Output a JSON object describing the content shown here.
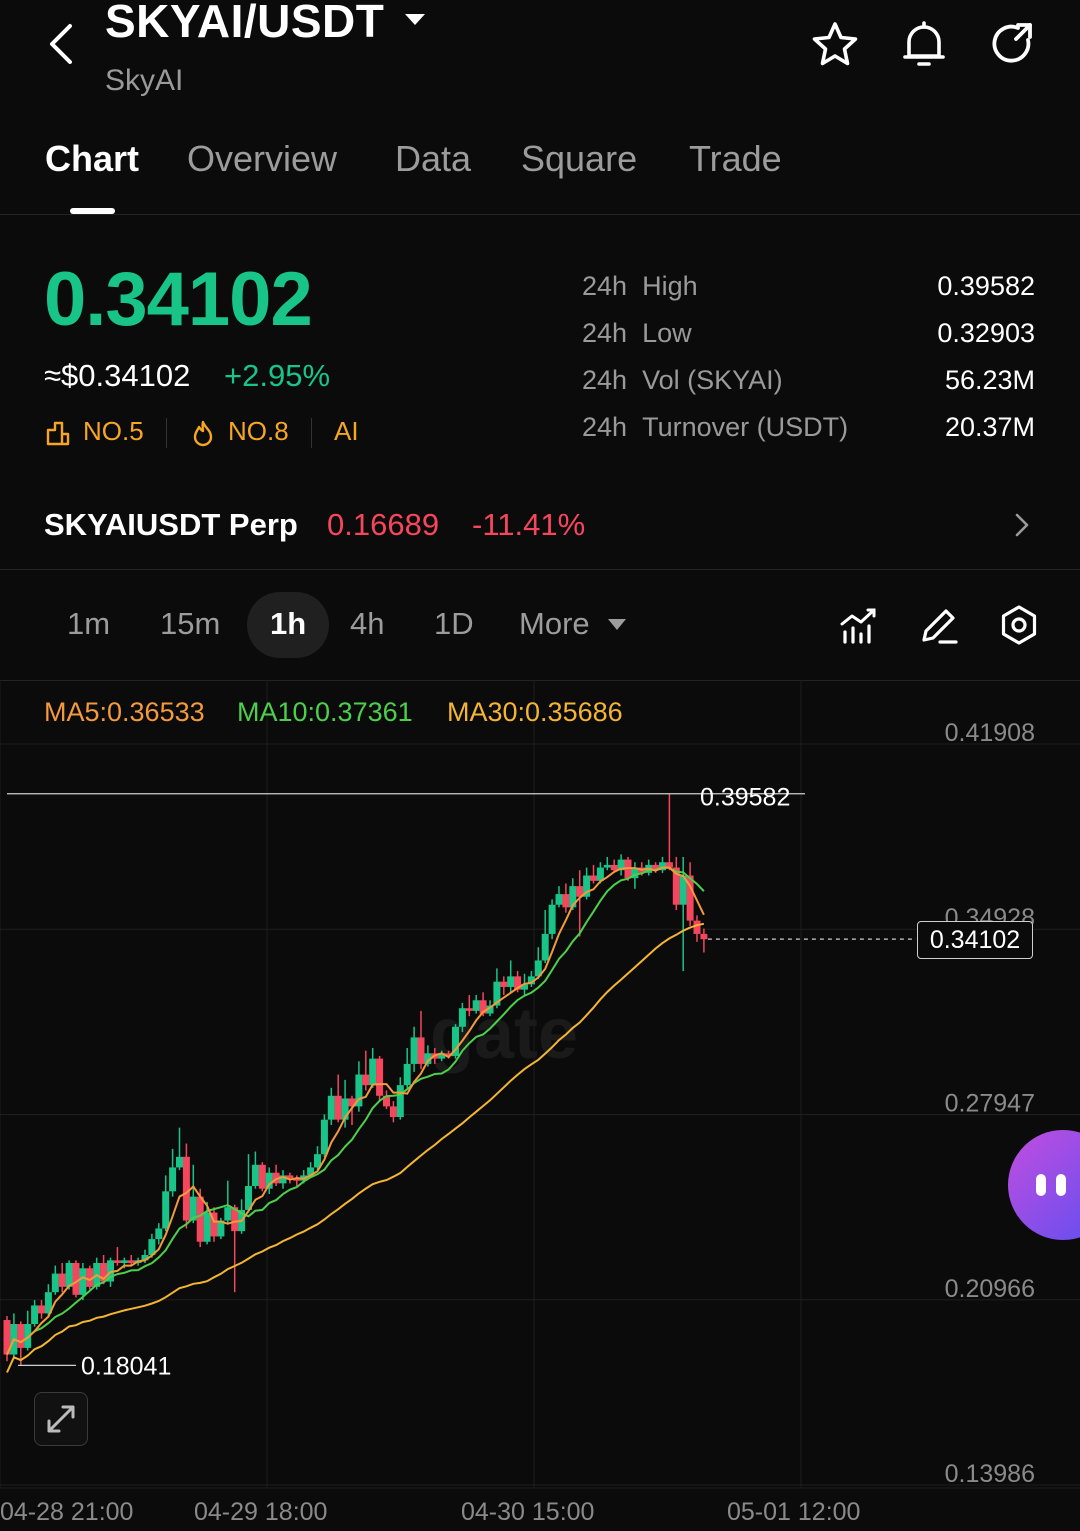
{
  "header": {
    "pair": "SKYAI/USDT",
    "name": "SkyAI"
  },
  "tabs": [
    {
      "label": "Chart",
      "active": true
    },
    {
      "label": "Overview"
    },
    {
      "label": "Data"
    },
    {
      "label": "Square"
    },
    {
      "label": "Trade"
    }
  ],
  "price": {
    "last": "0.34102",
    "usd": "≈$0.34102",
    "change": "+2.95%",
    "badges": [
      {
        "icon": "rank-icon",
        "label": "NO.5"
      },
      {
        "icon": "flame-icon",
        "label": "NO.8"
      },
      {
        "label": "AI"
      }
    ]
  },
  "stats": [
    {
      "period": "24h",
      "label": "High",
      "value": "0.39582"
    },
    {
      "period": "24h",
      "label": "Low",
      "value": "0.32903"
    },
    {
      "period": "24h",
      "label": "Vol (SKYAI)",
      "value": "56.23M"
    },
    {
      "period": "24h",
      "label": "Turnover (USDT)",
      "value": "20.37M"
    }
  ],
  "perp": {
    "name": "SKYAIUSDT Perp",
    "price": "0.16689",
    "change": "-11.41%"
  },
  "intervals": [
    "1m",
    "15m",
    "1h",
    "4h",
    "1D",
    "More"
  ],
  "active_interval": "1h",
  "ma": {
    "ma5": "MA5:0.36533",
    "ma10": "MA10:0.37361",
    "ma30": "MA30:0.35686"
  },
  "colors": {
    "up": "#19c489",
    "down": "#f6465d",
    "ma5": "#f59a3b",
    "ma10": "#4cd04c",
    "ma30": "#f5b533",
    "badge": "#f6a623"
  },
  "watermark": "gate",
  "chart_data": {
    "type": "candlestick",
    "ylim": [
      0.13986,
      0.44
    ],
    "y_ticks": [
      "0.41908",
      "0.34928",
      "0.27947",
      "0.20966",
      "0.13986"
    ],
    "x_ticks": [
      "04-28 21:00",
      "04-29 18:00",
      "04-30 15:00",
      "05-01 12:00"
    ],
    "high_label": "0.39582",
    "low_label": "0.18041",
    "current_price": 0.34102,
    "current_label": "0.34102",
    "candles": [
      [
        0.1975,
        0.1845,
        0.199,
        0.182
      ],
      [
        0.1845,
        0.196,
        0.2,
        0.183
      ],
      [
        0.196,
        0.187,
        0.197,
        0.1804
      ],
      [
        0.187,
        0.196,
        0.201,
        0.186
      ],
      [
        0.196,
        0.203,
        0.205,
        0.195
      ],
      [
        0.203,
        0.2,
        0.205,
        0.198
      ],
      [
        0.2,
        0.208,
        0.211,
        0.199
      ],
      [
        0.208,
        0.215,
        0.218,
        0.207
      ],
      [
        0.215,
        0.21,
        0.219,
        0.208
      ],
      [
        0.21,
        0.219,
        0.22,
        0.209
      ],
      [
        0.219,
        0.207,
        0.22,
        0.206
      ],
      [
        0.207,
        0.217,
        0.219,
        0.205
      ],
      [
        0.217,
        0.21,
        0.218,
        0.209
      ],
      [
        0.21,
        0.219,
        0.221,
        0.209
      ],
      [
        0.219,
        0.212,
        0.222,
        0.211
      ],
      [
        0.212,
        0.22,
        0.221,
        0.21
      ],
      [
        0.22,
        0.219,
        0.225,
        0.218
      ],
      [
        0.219,
        0.22,
        0.221,
        0.217
      ],
      [
        0.22,
        0.219,
        0.222,
        0.218
      ],
      [
        0.219,
        0.22,
        0.221,
        0.218
      ],
      [
        0.22,
        0.222,
        0.224,
        0.219
      ],
      [
        0.222,
        0.228,
        0.23,
        0.221
      ],
      [
        0.228,
        0.232,
        0.234,
        0.226
      ],
      [
        0.232,
        0.246,
        0.252,
        0.231
      ],
      [
        0.246,
        0.255,
        0.262,
        0.244
      ],
      [
        0.255,
        0.259,
        0.27,
        0.254
      ],
      [
        0.259,
        0.235,
        0.264,
        0.232
      ],
      [
        0.235,
        0.244,
        0.256,
        0.234
      ],
      [
        0.244,
        0.227,
        0.247,
        0.225
      ],
      [
        0.227,
        0.238,
        0.242,
        0.226
      ],
      [
        0.238,
        0.229,
        0.24,
        0.227
      ],
      [
        0.229,
        0.235,
        0.236,
        0.228
      ],
      [
        0.235,
        0.24,
        0.25,
        0.234
      ],
      [
        0.24,
        0.231,
        0.241,
        0.208
      ],
      [
        0.231,
        0.239,
        0.243,
        0.23
      ],
      [
        0.239,
        0.248,
        0.26,
        0.238
      ],
      [
        0.248,
        0.256,
        0.261,
        0.247
      ],
      [
        0.256,
        0.247,
        0.257,
        0.246
      ],
      [
        0.247,
        0.253,
        0.255,
        0.245
      ],
      [
        0.253,
        0.249,
        0.256,
        0.248
      ],
      [
        0.249,
        0.252,
        0.254,
        0.247
      ],
      [
        0.252,
        0.251,
        0.253,
        0.249
      ],
      [
        0.251,
        0.25,
        0.252,
        0.248
      ],
      [
        0.25,
        0.252,
        0.254,
        0.249
      ],
      [
        0.252,
        0.255,
        0.257,
        0.251
      ],
      [
        0.255,
        0.26,
        0.263,
        0.254
      ],
      [
        0.26,
        0.273,
        0.275,
        0.259
      ],
      [
        0.273,
        0.282,
        0.285,
        0.271
      ],
      [
        0.282,
        0.273,
        0.29,
        0.272
      ],
      [
        0.273,
        0.281,
        0.288,
        0.27
      ],
      [
        0.281,
        0.278,
        0.282,
        0.271
      ],
      [
        0.278,
        0.29,
        0.295,
        0.276
      ],
      [
        0.29,
        0.286,
        0.299,
        0.284
      ],
      [
        0.286,
        0.296,
        0.3,
        0.285
      ],
      [
        0.296,
        0.282,
        0.297,
        0.28
      ],
      [
        0.282,
        0.278,
        0.284,
        0.277
      ],
      [
        0.278,
        0.274,
        0.28,
        0.272
      ],
      [
        0.274,
        0.286,
        0.289,
        0.273
      ],
      [
        0.286,
        0.294,
        0.3,
        0.285
      ],
      [
        0.294,
        0.304,
        0.308,
        0.291
      ],
      [
        0.304,
        0.294,
        0.314,
        0.292
      ],
      [
        0.294,
        0.298,
        0.301,
        0.293
      ],
      [
        0.298,
        0.296,
        0.3,
        0.294
      ],
      [
        0.296,
        0.298,
        0.299,
        0.295
      ],
      [
        0.298,
        0.297,
        0.299,
        0.296
      ],
      [
        0.297,
        0.308,
        0.309,
        0.296
      ],
      [
        0.308,
        0.315,
        0.317,
        0.306
      ],
      [
        0.315,
        0.314,
        0.32,
        0.312
      ],
      [
        0.314,
        0.318,
        0.32,
        0.313
      ],
      [
        0.318,
        0.313,
        0.321,
        0.312
      ],
      [
        0.313,
        0.316,
        0.318,
        0.312
      ],
      [
        0.316,
        0.325,
        0.33,
        0.315
      ],
      [
        0.325,
        0.323,
        0.327,
        0.32
      ],
      [
        0.323,
        0.327,
        0.333,
        0.321
      ],
      [
        0.327,
        0.322,
        0.329,
        0.321
      ],
      [
        0.322,
        0.324,
        0.328,
        0.32
      ],
      [
        0.324,
        0.327,
        0.329,
        0.323
      ],
      [
        0.327,
        0.333,
        0.338,
        0.326
      ],
      [
        0.333,
        0.343,
        0.352,
        0.332
      ],
      [
        0.343,
        0.354,
        0.356,
        0.341
      ],
      [
        0.354,
        0.358,
        0.361,
        0.353
      ],
      [
        0.358,
        0.353,
        0.362,
        0.351
      ],
      [
        0.353,
        0.361,
        0.364,
        0.352
      ],
      [
        0.361,
        0.357,
        0.367,
        0.342
      ],
      [
        0.357,
        0.365,
        0.368,
        0.356
      ],
      [
        0.365,
        0.363,
        0.369,
        0.362
      ],
      [
        0.363,
        0.368,
        0.37,
        0.362
      ],
      [
        0.368,
        0.369,
        0.372,
        0.367
      ],
      [
        0.369,
        0.367,
        0.371,
        0.366
      ],
      [
        0.367,
        0.371,
        0.373,
        0.365
      ],
      [
        0.371,
        0.364,
        0.372,
        0.363
      ],
      [
        0.364,
        0.368,
        0.37,
        0.36
      ],
      [
        0.368,
        0.366,
        0.37,
        0.365
      ],
      [
        0.366,
        0.369,
        0.371,
        0.365
      ],
      [
        0.369,
        0.367,
        0.37,
        0.366
      ],
      [
        0.367,
        0.37,
        0.372,
        0.366
      ],
      [
        0.37,
        0.368,
        0.3958,
        0.367
      ],
      [
        0.368,
        0.354,
        0.372,
        0.352
      ],
      [
        0.354,
        0.365,
        0.372,
        0.329
      ],
      [
        0.365,
        0.348,
        0.37,
        0.346
      ],
      [
        0.348,
        0.343,
        0.35,
        0.34
      ],
      [
        0.343,
        0.341,
        0.345,
        0.336
      ]
    ]
  }
}
